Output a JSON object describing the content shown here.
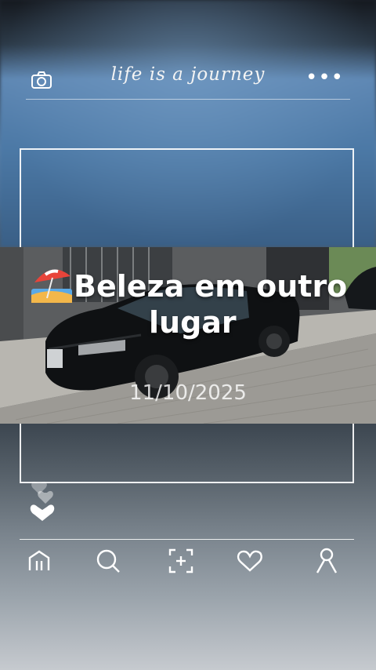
{
  "header": {
    "title": "life is a journey",
    "camera_icon": "camera-icon",
    "more_icon": "more-dots-icon",
    "more_label": "•••"
  },
  "post": {
    "caption_line1": "Beleza em outro",
    "caption_line2": "lugar",
    "caption_emoji": "beach-umbrella-icon",
    "date": "11/10/2025"
  },
  "nav": {
    "items": [
      {
        "name": "home",
        "icon": "home-icon"
      },
      {
        "name": "search",
        "icon": "search-icon"
      },
      {
        "name": "add",
        "icon": "add-photo-icon"
      },
      {
        "name": "likes",
        "icon": "heart-icon"
      },
      {
        "name": "profile",
        "icon": "profile-icon"
      }
    ]
  },
  "colors": {
    "accent": "#ffffff",
    "frame": "#ffffff"
  }
}
